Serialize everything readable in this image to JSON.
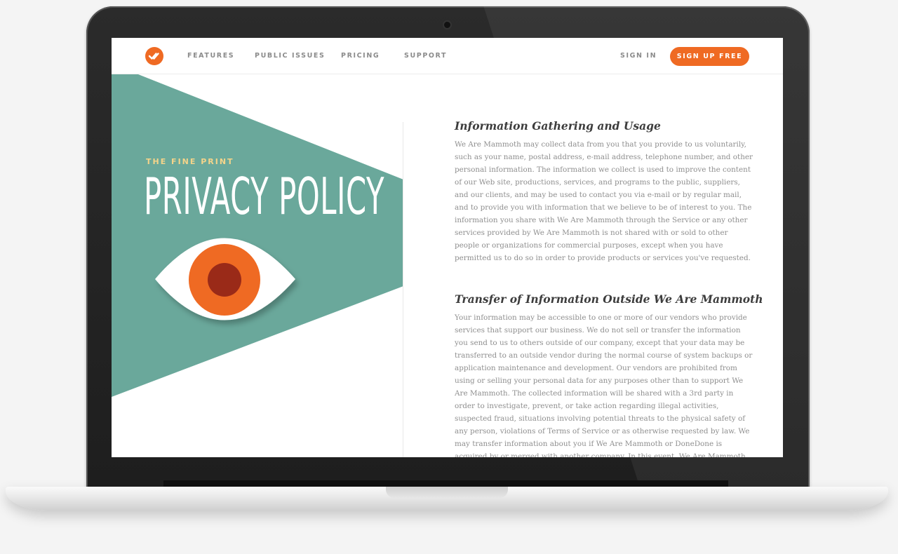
{
  "colors": {
    "accent": "#ef6a23",
    "teal": "#6aa89b",
    "eye_iris": "#ef6a23",
    "eye_pupil": "#9a2a18",
    "fine_print": "#f5d48a"
  },
  "nav": {
    "logo_icon": "check-circle-icon",
    "links": [
      "FEATURES",
      "PUBLIC ISSUES",
      "PRICING",
      "SUPPORT"
    ],
    "sign_in": "SIGN IN",
    "sign_up": "SIGN UP FREE"
  },
  "hero": {
    "eyebrow": "THE FINE PRINT",
    "title": "PRIVACY POLICY",
    "eye_icon": "eye-icon"
  },
  "sections": [
    {
      "heading": "Information Gathering and Usage",
      "body": "We Are Mammoth may collect data from you that you provide to us voluntarily, such as your name, postal address, e-mail address, telephone number, and other personal information. The information we collect is used to improve the content of our Web site, productions, services, and programs to the public, suppliers, and our clients, and may be used to contact you via e-mail or by regular mail, and to provide you with information that we believe to be of interest to you. The information you share with We Are Mammoth through the Service or any other services provided by We Are Mammoth is not shared with or sold to other people or organizations for commercial purposes, except when you have permitted us to do so in order to provide products or services you've requested."
    },
    {
      "heading": "Transfer of Information Outside We Are Mammoth",
      "body": "Your information may be accessible to one or more of our vendors who provide services that support our business. We do not sell or transfer the information you send to us to others outside of our company, except that your data may be transferred to an outside vendor during the normal course of system backups or application maintenance and development. Our vendors are prohibited from using or selling your personal data for any purposes other than to support We Are Mammoth. The collected information will be shared with a 3rd party in order to investigate, prevent, or take action regarding illegal activities, suspected fraud, situations involving potential threats to the physical safety of any person, violations of Terms of Service or as otherwise requested by law. We may transfer information about you if We Are Mammoth or DoneDone is acquired by or merged with another company. In this event, We Are Mammoth will notify you before information about you is"
    }
  ]
}
